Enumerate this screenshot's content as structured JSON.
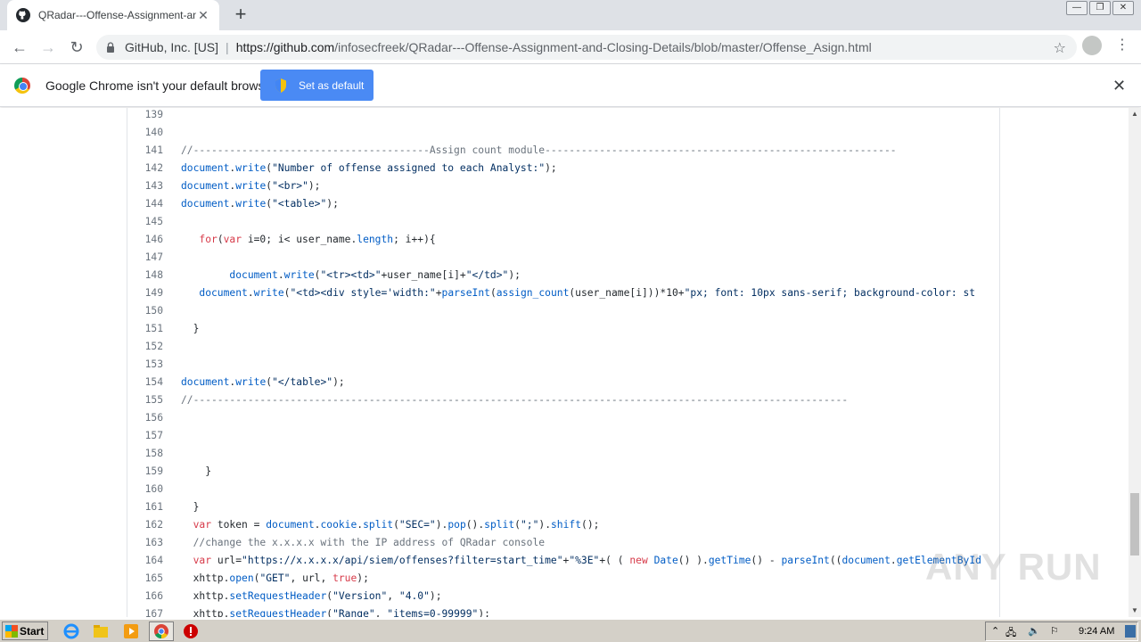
{
  "browser": {
    "tab_title": "QRadar---Offense-Assignment-and-",
    "tab_close": "✕",
    "new_tab": "+",
    "org": "GitHub, Inc. [US]",
    "url_host": "https://github.com",
    "url_path": "/infosecfreek/QRadar---Offense-Assignment-and-Closing-Details/blob/master/Offense_Asign.html",
    "star": "☆",
    "menu": "⋮"
  },
  "infobar": {
    "message": "Google Chrome isn't your default browser",
    "button": "Set as default",
    "close": "✕"
  },
  "code": {
    "lines": [
      {
        "n": "139",
        "t": ""
      },
      {
        "n": "140",
        "t": ""
      },
      {
        "n": "141",
        "t": "//---------------------------------------Assign count module----------------------------------------------------------"
      },
      {
        "n": "142",
        "t": "document.write(\"Number of offense assigned to each Analyst:\");"
      },
      {
        "n": "143",
        "t": "document.write(\"<br>\");"
      },
      {
        "n": "144",
        "t": "document.write(\"<table>\");"
      },
      {
        "n": "145",
        "t": ""
      },
      {
        "n": "146",
        "t": "   for(var i=0; i< user_name.length; i++){"
      },
      {
        "n": "147",
        "t": ""
      },
      {
        "n": "148",
        "t": "        document.write(\"<tr><td>\"+user_name[i]+\"</td>\");"
      },
      {
        "n": "149",
        "t": "   document.write(\"<td><div style='width:\"+parseInt(assign_count(user_name[i]))*10+\"px; font: 10px sans-serif; background-color: st"
      },
      {
        "n": "150",
        "t": ""
      },
      {
        "n": "151",
        "t": "  }"
      },
      {
        "n": "152",
        "t": ""
      },
      {
        "n": "153",
        "t": ""
      },
      {
        "n": "154",
        "t": "document.write(\"</table>\");"
      },
      {
        "n": "155",
        "t": "//------------------------------------------------------------------------------------------------------------"
      },
      {
        "n": "156",
        "t": ""
      },
      {
        "n": "157",
        "t": ""
      },
      {
        "n": "158",
        "t": ""
      },
      {
        "n": "159",
        "t": "    }"
      },
      {
        "n": "160",
        "t": ""
      },
      {
        "n": "161",
        "t": "  }"
      },
      {
        "n": "162",
        "t": "  var token = document.cookie.split(\"SEC=\").pop().split(\";\").shift();"
      },
      {
        "n": "163",
        "t": "  //change the x.x.x.x with the IP address of QRadar console"
      },
      {
        "n": "164",
        "t": "  var url=\"https://x.x.x.x/api/siem/offenses?filter=start_time\"+\"%3E\"+( ( new Date() ).getTime() - parseInt((document.getElementById"
      },
      {
        "n": "165",
        "t": "  xhttp.open(\"GET\", url, true);"
      },
      {
        "n": "166",
        "t": "  xhttp.setRequestHeader(\"Version\", \"4.0\");"
      },
      {
        "n": "167",
        "t": "  xhttp.setRequestHeader(\"Range\", \"items=0-99999\");"
      }
    ]
  },
  "watermark": "ANY RUN",
  "taskbar": {
    "start": "Start",
    "clock": "9:24 AM"
  }
}
